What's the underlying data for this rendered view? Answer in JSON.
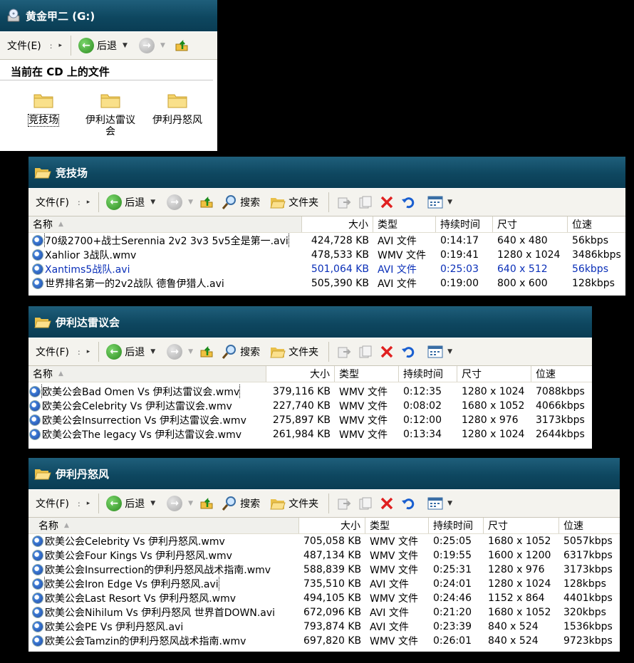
{
  "toolbar": {
    "file": "文件(F)",
    "back": "后退",
    "search": "搜索",
    "folders": "文件夹"
  },
  "cd_window": {
    "title": "黄金甲二 (G:)",
    "file": "文件(E)",
    "back": "后退",
    "heading": "当前在 CD 上的文件",
    "folders": [
      {
        "label": "竞技场",
        "selected": true
      },
      {
        "label": "伊利达雷议\n会",
        "selected": false
      },
      {
        "label": "伊利丹怒风",
        "selected": false
      }
    ]
  },
  "columns": {
    "name": "名称",
    "size": "大小",
    "type": "类型",
    "duration": "持续时间",
    "dimensions": "尺寸",
    "bitrate": "位速"
  },
  "win_arena": {
    "title": "竞技场",
    "files": [
      {
        "name": "70级2700+战士Serennia 2v2 3v3 5v5全是第一.avi",
        "size": "424,728 KB",
        "type": "AVI 文件",
        "duration": "0:14:17",
        "dimensions": "640 x 480",
        "bitrate": "56kbps"
      },
      {
        "name": "Xahlior 3战队.wmv",
        "size": "478,533 KB",
        "type": "WMV 文件",
        "duration": "0:19:41",
        "dimensions": "1280 x 1024",
        "bitrate": "3486kbps"
      },
      {
        "name": "Xantims5战队.avi",
        "size": "501,064 KB",
        "type": "AVI 文件",
        "duration": "0:25:03",
        "dimensions": "640 x 512",
        "bitrate": "56kbps"
      },
      {
        "name": "世界排名第一的2v2战队 德鲁伊猎人.avi",
        "size": "505,390 KB",
        "type": "AVI 文件",
        "duration": "0:19:00",
        "dimensions": "800 x 600",
        "bitrate": "128kbps"
      }
    ]
  },
  "win_illidari": {
    "title": "伊利达雷议会",
    "files": [
      {
        "name": "欧美公会Bad Omen Vs 伊利达雷议会.wmv",
        "size": "379,116 KB",
        "type": "WMV 文件",
        "duration": "0:12:35",
        "dimensions": "1280 x 1024",
        "bitrate": "7088kbps"
      },
      {
        "name": "欧美公会Celebrity Vs 伊利达雷议会.wmv",
        "size": "227,740 KB",
        "type": "WMV 文件",
        "duration": "0:08:02",
        "dimensions": "1680 x 1052",
        "bitrate": "4066kbps"
      },
      {
        "name": "欧美公会Insurrection Vs 伊利达雷议会.wmv",
        "size": "275,897 KB",
        "type": "WMV 文件",
        "duration": "0:12:00",
        "dimensions": "1280 x 976",
        "bitrate": "3173kbps"
      },
      {
        "name": "欧美公会The legacy Vs 伊利达雷议会.wmv",
        "size": "261,984 KB",
        "type": "WMV 文件",
        "duration": "0:13:34",
        "dimensions": "1280 x 1024",
        "bitrate": "2644kbps"
      }
    ]
  },
  "win_illidan": {
    "title": "伊利丹怒风",
    "files": [
      {
        "name": "欧美公会Celebrity Vs 伊利丹怒风.wmv",
        "size": "705,058 KB",
        "type": "WMV 文件",
        "duration": "0:25:05",
        "dimensions": "1680 x 1052",
        "bitrate": "5057kbps"
      },
      {
        "name": "欧美公会Four Kings Vs 伊利丹怒风.wmv",
        "size": "487,134 KB",
        "type": "WMV 文件",
        "duration": "0:19:55",
        "dimensions": "1600 x 1200",
        "bitrate": "6317kbps"
      },
      {
        "name": "欧美公会Insurrection的伊利丹怒风战术指南.wmv",
        "size": "588,839 KB",
        "type": "WMV 文件",
        "duration": "0:25:31",
        "dimensions": "1280 x 976",
        "bitrate": "3173kbps"
      },
      {
        "name": "欧美公会Iron Edge Vs 伊利丹怒风.avi",
        "size": "735,510 KB",
        "type": "AVI 文件",
        "duration": "0:24:01",
        "dimensions": "1280 x 1024",
        "bitrate": "128kbps"
      },
      {
        "name": "欧美公会Last Resort Vs 伊利丹怒风.wmv",
        "size": "494,105 KB",
        "type": "WMV 文件",
        "duration": "0:24:46",
        "dimensions": "1152 x 864",
        "bitrate": "4401kbps"
      },
      {
        "name": "欧美公会Nihilum Vs 伊利丹怒风 世界首DOWN.avi",
        "size": "672,096 KB",
        "type": "AVI 文件",
        "duration": "0:21:20",
        "dimensions": "1680 x 1052",
        "bitrate": "320kbps"
      },
      {
        "name": "欧美公会PE Vs 伊利丹怒风.avi",
        "size": "793,874 KB",
        "type": "AVI 文件",
        "duration": "0:23:39",
        "dimensions": "840 x 524",
        "bitrate": "1536kbps"
      },
      {
        "name": "欧美公会Tamzin的伊利丹怒风战术指南.wmv",
        "size": "697,820 KB",
        "type": "WMV 文件",
        "duration": "0:26:01",
        "dimensions": "840 x 524",
        "bitrate": "9723kbps"
      }
    ]
  }
}
